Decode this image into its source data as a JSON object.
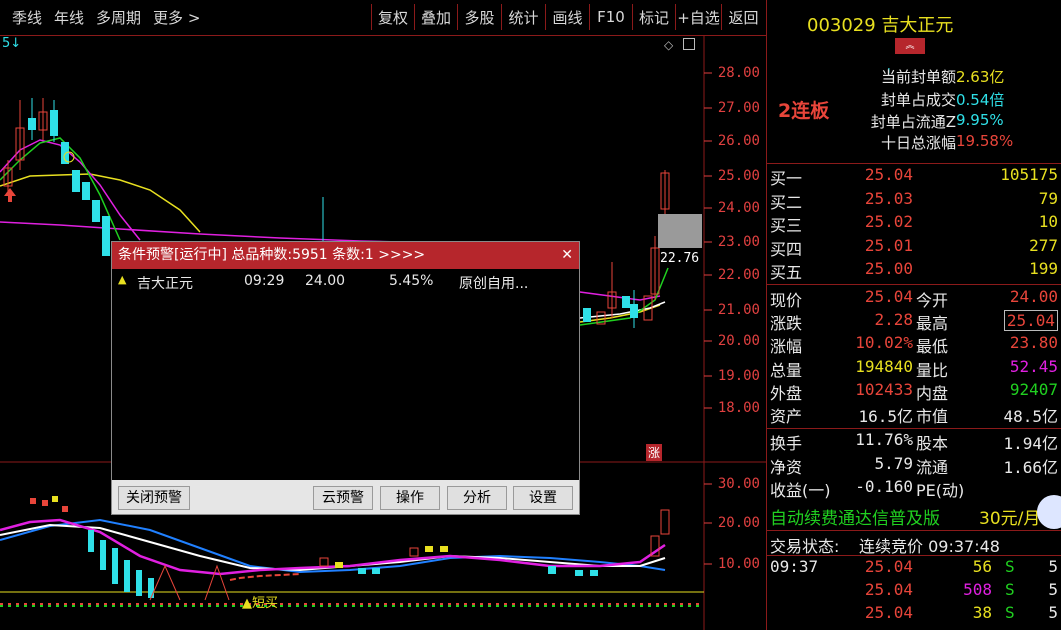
{
  "toolbar": {
    "periods": [
      "季线",
      "年线",
      "多周期",
      "更多 >"
    ],
    "tools": [
      "复权",
      "叠加",
      "多股",
      "统计",
      "画线",
      "F10",
      "标记",
      "+自选",
      "返回"
    ]
  },
  "chart": {
    "price_labels": [
      "28.00",
      "27.00",
      "26.00",
      "25.00",
      "24.00",
      "23.00",
      "22.00",
      "21.00",
      "20.00",
      "19.00",
      "18.00"
    ],
    "indicator_labels": [
      "30.00",
      "20.00",
      "10.00"
    ],
    "top_left_marker": "5↓",
    "current_price_tag": "22.76",
    "zhang_tag": "涨",
    "short_buy_label": "▲短买",
    "colors": {
      "up": "#e8453a",
      "down": "#2fe0e8",
      "ma_white": "#ffffff",
      "ma_yellow": "#e8e020",
      "ma_magenta": "#e020e0",
      "ma_green": "#20d020"
    }
  },
  "stock": {
    "code": "003029",
    "name": "吉大正元",
    "name_title": "003029 吉大正元",
    "board": "2连板"
  },
  "seal_info": [
    {
      "label": "当前封单额",
      "value": "2.63亿",
      "color": "#e8e020"
    },
    {
      "label": "封单占成交",
      "value": "0.54倍",
      "color": "#2fe0e8"
    },
    {
      "label": "封单占流通Z",
      "value": "9.95%",
      "color": "#2fe0e8"
    },
    {
      "label": "十日总涨幅",
      "value": "19.58%",
      "color": "#e8453a"
    }
  ],
  "bids": [
    {
      "label": "买一",
      "price": "25.04",
      "vol": "105175"
    },
    {
      "label": "买二",
      "price": "25.03",
      "vol": "79"
    },
    {
      "label": "买三",
      "price": "25.02",
      "vol": "10"
    },
    {
      "label": "买四",
      "price": "25.01",
      "vol": "277"
    },
    {
      "label": "买五",
      "price": "25.00",
      "vol": "199"
    }
  ],
  "quote": [
    {
      "l1": "现价",
      "v1": "25.04",
      "c1": "#e8453a",
      "l2": "今开",
      "v2": "24.00",
      "c2": "#e8453a"
    },
    {
      "l1": "涨跌",
      "v1": "2.28",
      "c1": "#e8453a",
      "l2": "最高",
      "v2": "25.04",
      "c2": "#e8453a"
    },
    {
      "l1": "涨幅",
      "v1": "10.02%",
      "c1": "#e8453a",
      "l2": "最低",
      "v2": "23.80",
      "c2": "#e8453a"
    },
    {
      "l1": "总量",
      "v1": "194840",
      "c1": "#e8e020",
      "l2": "量比",
      "v2": "52.45",
      "c2": "#e020e0"
    },
    {
      "l1": "外盘",
      "v1": "102433",
      "c1": "#e8453a",
      "l2": "内盘",
      "v2": "92407",
      "c2": "#20d020"
    },
    {
      "l1": "资产",
      "v1": "16.5亿",
      "c1": "#e8e8e8",
      "l2": "市值",
      "v2": "48.5亿",
      "c2": "#e8e8e8"
    },
    {
      "l1": "换手",
      "v1": "11.76%",
      "c1": "#e8e8e8",
      "l2": "股本",
      "v2": "1.94亿",
      "c2": "#e8e8e8"
    },
    {
      "l1": "净资",
      "v1": "5.79",
      "c1": "#e8e8e8",
      "l2": "流通",
      "v2": "1.66亿",
      "c2": "#e8e8e8"
    },
    {
      "l1": "收益(一)",
      "v1": "-0.160",
      "c1": "#e8e8e8",
      "l2": "PE(动)",
      "v2": "",
      "c2": "#e8e8e8"
    }
  ],
  "ad": {
    "text": "自动续费通达信普及版",
    "price": "30元/月"
  },
  "trade_status": {
    "label": "交易状态:",
    "value": "连续竞价 09:37:48"
  },
  "ticks": [
    {
      "time": "09:37",
      "price": "25.04",
      "vol": "56",
      "vol_color": "#e8e020",
      "side": "S",
      "count": "5"
    },
    {
      "time": "",
      "price": "25.04",
      "vol": "508",
      "vol_color": "#e020e0",
      "side": "S",
      "count": "5"
    },
    {
      "time": "",
      "price": "25.04",
      "vol": "38",
      "vol_color": "#e8e020",
      "side": "S",
      "count": "5"
    }
  ],
  "alert_dialog": {
    "title": "条件预警[运行中] 总品种数:5951 条数:1  >>>>",
    "close_symbol": "✕",
    "rows": [
      {
        "name": "吉大正元",
        "time": "09:29",
        "price": "24.00",
        "pct": "5.45%",
        "note": "原创自用..."
      }
    ],
    "buttons": {
      "close_alert": "关闭预警",
      "cloud": "云预警",
      "operate": "操作",
      "analyze": "分析",
      "settings": "设置"
    }
  }
}
